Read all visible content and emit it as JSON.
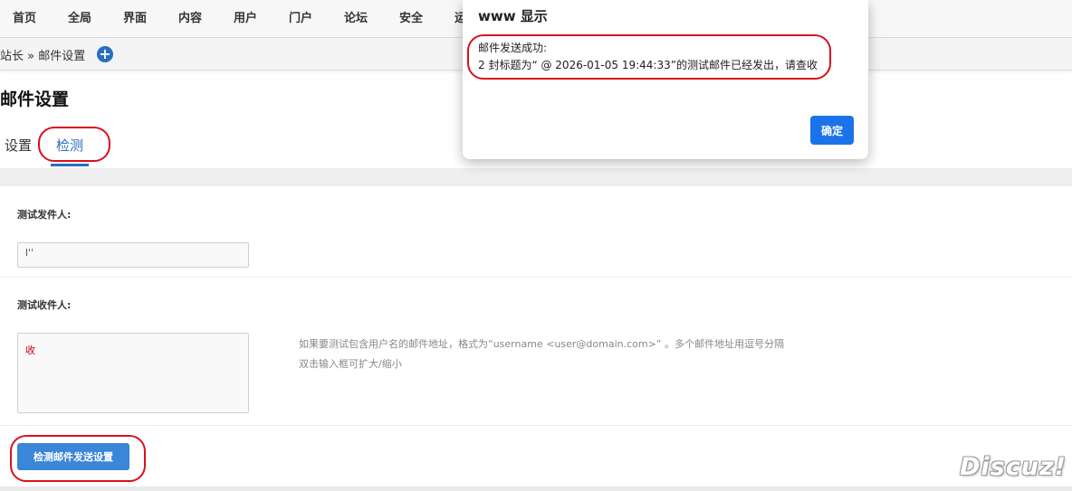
{
  "topnav": {
    "items": [
      "首页",
      "全局",
      "界面",
      "内容",
      "用户",
      "门户",
      "论坛",
      "安全",
      "运"
    ]
  },
  "breadcrumb": {
    "text": "站长 » 邮件设置",
    "add_icon": "plus-circle-icon"
  },
  "page": {
    "title": "邮件设置"
  },
  "tabs": [
    {
      "label": "设置",
      "active": false
    },
    {
      "label": "检测",
      "active": true
    }
  ],
  "form": {
    "sender_label": "测试发件人:",
    "sender_value": "l''",
    "receiver_label": "测试收件人:",
    "receiver_value": "收",
    "hint_line1": "如果要测试包含用户名的邮件地址，格式为“username <user@domain.com>” 。多个邮件地址用逗号分隔",
    "hint_line2": "双击输入框可扩大/缩小",
    "submit_label": "检测邮件发送设置"
  },
  "dialog": {
    "title": "www          显示",
    "line1": "邮件发送成功:",
    "line2": "2 封标题为“ @ 2026-01-05 19:44:33”的测试邮件已经发出，请查收",
    "ok_label": "确定"
  },
  "brand": {
    "logo_text": "Discuz!"
  },
  "colors": {
    "accent": "#2a6fbf",
    "button": "#3a86d8",
    "dialog_button": "#1a73e8",
    "annotation": "#d9101d"
  }
}
